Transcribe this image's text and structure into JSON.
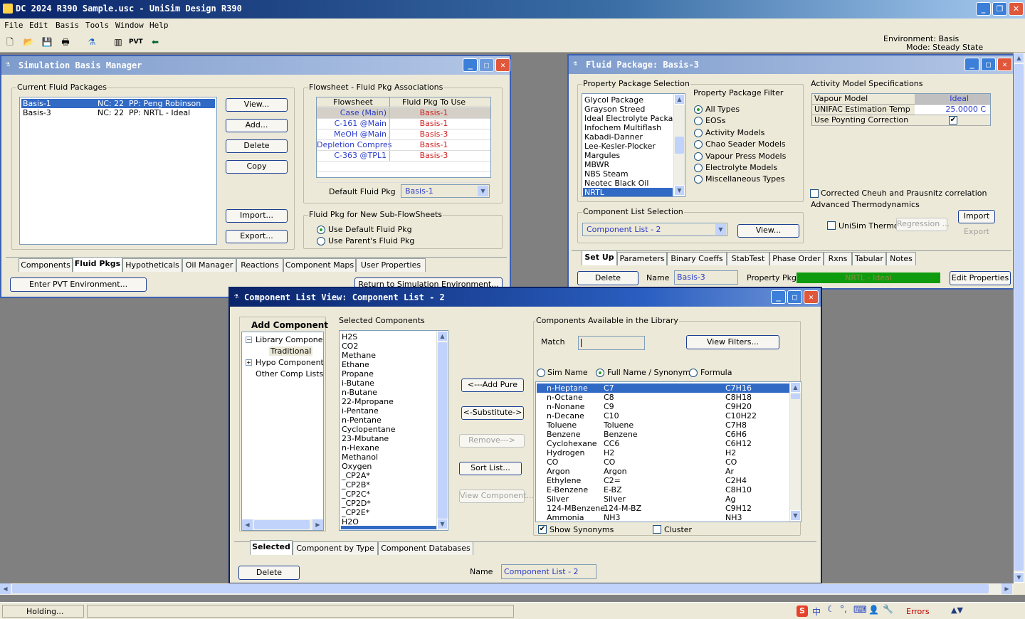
{
  "app": {
    "title": "DC 2024 R390 Sample.usc - UniSim Design R390"
  },
  "menu": [
    "File",
    "Edit",
    "Basis",
    "Tools",
    "Window",
    "Help"
  ],
  "env": {
    "environment": "Environment: Basis",
    "mode": "Mode: Steady State"
  },
  "sbm": {
    "title": "Simulation Basis Manager",
    "current_group": "Current Fluid Packages",
    "packages": [
      {
        "name": "Basis-1",
        "nc": "NC: 22",
        "pp": "PP: Peng Robinson"
      },
      {
        "name": "Basis-3",
        "nc": "NC: 22",
        "pp": "PP: NRTL - Ideal"
      }
    ],
    "buttons": {
      "view": "View...",
      "add": "Add...",
      "delete": "Delete",
      "copy": "Copy",
      "import": "Import...",
      "export": "Export..."
    },
    "assoc_group": "Flowsheet - Fluid Pkg Associations",
    "assoc_headers": [
      "Flowsheet",
      "Fluid Pkg To Use"
    ],
    "assoc_rows": [
      [
        "Case (Main)",
        "Basis-1"
      ],
      [
        "C-161 @Main",
        "Basis-1"
      ],
      [
        "MeOH @Main",
        "Basis-3"
      ],
      [
        "Depletion Compres",
        "Basis-1"
      ],
      [
        "C-363 @TPL1",
        "Basis-3"
      ]
    ],
    "default_label": "Default Fluid Pkg",
    "default_value": "Basis-1",
    "newsub_group": "Fluid Pkg for New Sub-FlowSheets",
    "radio_default": "Use Default Fluid Pkg",
    "radio_parent": "Use Parent's Fluid Pkg",
    "tabs": [
      "Components",
      "Fluid Pkgs",
      "Hypotheticals",
      "Oil Manager",
      "Reactions",
      "Component Maps",
      "User Properties"
    ],
    "pvt_button": "Enter PVT Environment...",
    "return_button": "Return to Simulation Environment..."
  },
  "fp": {
    "title": "Fluid Package: Basis-3",
    "pps_group": "Property Package Selection",
    "packages": [
      "Glycol Package",
      "Grayson Streed",
      "Ideal Electrolyte Package",
      "Infochem Multiflash",
      "Kabadi-Danner",
      "Lee-Kesler-Plocker",
      "Margules",
      "MBWR",
      "NBS Steam",
      "Neotec Black Oil",
      "NRTL"
    ],
    "filter_group": "Property Package Filter",
    "filters": [
      "All Types",
      "EOSs",
      "Activity Models",
      "Chao Seader Models",
      "Vapour Press Models",
      "Electrolyte Models",
      "Miscellaneous Types"
    ],
    "activity_group": "Activity Model Specifications",
    "activity_rows": [
      [
        "Vapour Model",
        "Ideal"
      ],
      [
        "UNIFAC Estimation Temp",
        "25.0000 C"
      ],
      [
        "Use Poynting Correction",
        "✔"
      ]
    ],
    "cheueh": "Corrected Cheuh and Prausnitz correlation",
    "adv_group": "Advanced Thermodynamics",
    "unisim_thermo": "UniSim Thermo",
    "regression": "Regression ...",
    "import": "Import",
    "export": "Export",
    "cls_group": "Component List Selection",
    "cls_value": "Component List - 2",
    "view": "View...",
    "tabs": [
      "Set Up",
      "Parameters",
      "Binary Coeffs",
      "StabTest",
      "Phase Order",
      "Rxns",
      "Tabular",
      "Notes"
    ],
    "delete": "Delete",
    "name_label": "Name",
    "name_value": "Basis-3",
    "pp_label": "Property Pkg",
    "pp_value": "NRTL - Ideal",
    "edit": "Edit Properties"
  },
  "clv": {
    "title": "Component List View: Component List - 2",
    "add_component": "Add Component",
    "tree": [
      "Library Components",
      "Traditional",
      "Hypo Components",
      "Other Comp Lists"
    ],
    "selected_group": "Selected Components",
    "selected": [
      "H2S",
      "CO2",
      "Methane",
      "Ethane",
      "Propane",
      "i-Butane",
      "n-Butane",
      "22-Mpropane",
      "i-Pentane",
      "n-Pentane",
      "Cyclopentane",
      "23-Mbutane",
      "n-Hexane",
      "Methanol",
      "Oxygen",
      "_CP2A*",
      "_CP2B*",
      "_CP2C*",
      "_CP2D*",
      "_CP2E*",
      "H2O"
    ],
    "buttons": {
      "add_pure": "<---Add Pure",
      "substitute": "<-Substitute->",
      "remove": "Remove--->",
      "sort": "Sort List...",
      "view_comp": "View Component..."
    },
    "avail_group": "Components Available in the Library",
    "match_label": "Match",
    "view_filters": "View Filters...",
    "radios": [
      "Sim Name",
      "Full Name / Synonym",
      "Formula"
    ],
    "library": [
      [
        "n-Heptane",
        "C7",
        "C7H16"
      ],
      [
        "n-Octane",
        "C8",
        "C8H18"
      ],
      [
        "n-Nonane",
        "C9",
        "C9H20"
      ],
      [
        "n-Decane",
        "C10",
        "C10H22"
      ],
      [
        "Toluene",
        "Toluene",
        "C7H8"
      ],
      [
        "Benzene",
        "Benzene",
        "C6H6"
      ],
      [
        "Cyclohexane",
        "CC6",
        "C6H12"
      ],
      [
        "Hydrogen",
        "H2",
        "H2"
      ],
      [
        "CO",
        "CO",
        "CO"
      ],
      [
        "Argon",
        "Argon",
        "Ar"
      ],
      [
        "Ethylene",
        "C2=",
        "C2H4"
      ],
      [
        "E-Benzene",
        "E-BZ",
        "C8H10"
      ],
      [
        "Silver",
        "Silver",
        "Ag"
      ],
      [
        "124-MBenzene",
        "124-M-BZ",
        "C9H12"
      ],
      [
        "Ammonia",
        "NH3",
        "NH3"
      ]
    ],
    "show_synonyms": "Show Synonyms",
    "cluster": "Cluster",
    "tabs": [
      "Selected",
      "Component by Type",
      "Component Databases"
    ],
    "delete": "Delete",
    "name_label": "Name",
    "name_value": "Component List - 2"
  },
  "status": {
    "holding": "Holding...",
    "errors": "Errors"
  }
}
